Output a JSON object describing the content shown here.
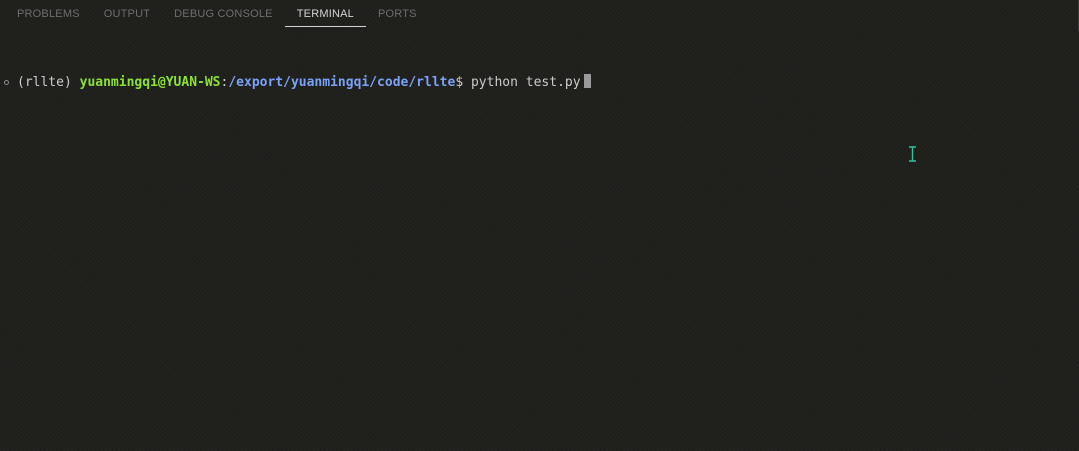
{
  "tabs": [
    {
      "label": "PROBLEMS",
      "active": false
    },
    {
      "label": "OUTPUT",
      "active": false
    },
    {
      "label": "DEBUG CONSOLE",
      "active": false
    },
    {
      "label": "TERMINAL",
      "active": true
    },
    {
      "label": "PORTS",
      "active": false
    }
  ],
  "terminal": {
    "env": "(rllte)",
    "user_host": "yuanmingqi@YUAN-WS",
    "separator": ":",
    "path": "/export/yuanmingqi/code/rllte",
    "prompt_symbol": "$",
    "command": "python test.py"
  },
  "colors": {
    "user_host": "#8ae234",
    "path": "#7aa2f7",
    "ibeam": "#2ec4a0"
  },
  "icons": {
    "gutter": "circle-decoration-icon",
    "mouse": "text-cursor-ibeam-icon"
  }
}
